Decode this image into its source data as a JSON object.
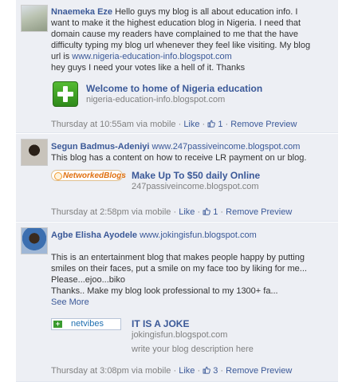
{
  "comments": [
    {
      "author": "Nnaemeka Eze",
      "author_link": "",
      "text_lines": [
        "Hello guys my blog is all about education info. I",
        "want to make it the highest education blog in Nigeria. I need that",
        "domain cause my readers have complained to me that the have",
        "difficulty typing my blog url whenever they feel like visiting. My blog",
        "url is "
      ],
      "inline_link": "www.nigeria-education-info.blogspot.com",
      "extra_line": "hey guys I need your votes like a hell of it. Thanks",
      "preview": {
        "title": "Welcome to home of Nigeria education",
        "url": "nigeria-education-info.blogspot.com",
        "description": "",
        "thumb_icon": "green-plus-icon"
      },
      "footer": {
        "time": "Thursday at 10:55am via mobile",
        "like_label": "Like",
        "like_count": "1",
        "remove_label": "Remove Preview"
      }
    },
    {
      "author": "Segun Badmus-Adeniyi",
      "author_link": "www.247passiveincome.blogspot.com",
      "text_lines": [
        "This blog has a content on how to receive LR payment on ur blog."
      ],
      "preview": {
        "title": "Make Up To $50 daily Online",
        "url": "247passiveincome.blogspot.com",
        "description": "",
        "thumb_icon": "networked-blogs-logo",
        "thumb_text": "NetworkedBlogs"
      },
      "footer": {
        "time": "Thursday at 2:58pm via mobile",
        "like_label": "Like",
        "like_count": "1",
        "remove_label": "Remove Preview"
      }
    },
    {
      "author": "Agbe Elisha Ayodele",
      "author_link": "www.jokingisfun.blogspot.com",
      "text_lines": [
        "This is an entertainment blog that makes people happy by putting",
        "smiles on their faces, put a smile on my face too by liking for me...",
        "Please...ejoo...biko",
        "Thanks.. Make my blog look professional to my 1300+ fa..."
      ],
      "see_more": "See More",
      "preview": {
        "title": "IT IS A JOKE",
        "url": "jokingisfun.blogspot.com",
        "description": "write your blog description here",
        "thumb_icon": "netvibes-logo",
        "thumb_text": "netvibes"
      },
      "footer": {
        "time": "Thursday at 3:08pm via mobile",
        "like_label": "Like",
        "like_count": "3",
        "remove_label": "Remove Preview"
      }
    }
  ]
}
